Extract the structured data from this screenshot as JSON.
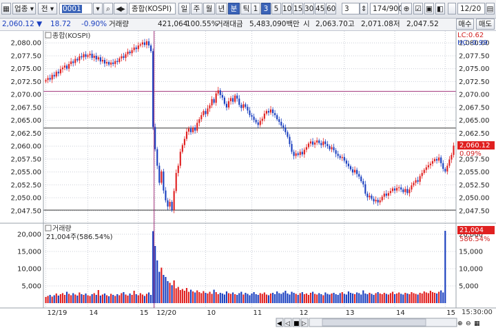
{
  "toolbar": {
    "market_select": "업종",
    "view_select": "전",
    "code_value": "0001",
    "index_name": "종합(KOSPI)",
    "periods": [
      "일",
      "주",
      "월",
      "년",
      "분",
      "틱"
    ],
    "intervals": [
      "1",
      "3",
      "5",
      "10",
      "15",
      "30",
      "45",
      "60"
    ],
    "interval_value": "3",
    "count_value": "174/900",
    "date_value": "12/20"
  },
  "info": {
    "price": "2,060.12",
    "change": "18.72",
    "rate": "-0.90%",
    "vol_label": "거래량",
    "volume": "421,064",
    "vol_ratio": "100.55%",
    "amount_label": "거래대금",
    "amount": "5,483,090백만",
    "open_label": "시",
    "open": "2,063.70",
    "high_label": "고",
    "high": "2,071.08",
    "low_label": "저",
    "low": "2,047.52",
    "buy_label": "매수",
    "sell_label": "매도"
  },
  "panel": {
    "price_title": "종합(KOSPI)",
    "lc_label": "LC:0.62",
    "hc_label": "HC:-0.99",
    "last_price_tag": "2,060.12",
    "last_pct_tag": "0.09%",
    "volume_title": "거래량",
    "volume_subtitle": "21,004주(586.54%)",
    "last_vol_tag": "21,004",
    "last_vol_pct_tag": "586.54%",
    "time_readout": "15:30:00"
  },
  "chart_data": {
    "type": "candlestick",
    "price_axis": {
      "min": 2046.0,
      "max": 2081.5,
      "ticks": [
        2047.5,
        2050,
        2052.5,
        2055,
        2057.5,
        2060,
        2062.5,
        2065,
        2067.5,
        2070,
        2072.5,
        2075,
        2077.5,
        2080
      ],
      "tick_labels": [
        "2,047.50",
        "2,050.00",
        "2,052.50",
        "2,055.00",
        "2,057.50",
        "2,060.00",
        "2,062.50",
        "2,065.00",
        "2,067.50",
        "2,070.00",
        "2,072.50",
        "2,075.00",
        "2,077.50",
        "2,080.00"
      ]
    },
    "volume_axis": {
      "min": 0,
      "max": 22000,
      "ticks": [
        5000,
        10000,
        15000,
        20000
      ],
      "tick_labels": [
        "5,000",
        "10,000",
        "15,000",
        "20,000"
      ]
    },
    "hlines": [
      {
        "value": 2070.6,
        "color": "#a0307a"
      },
      {
        "value": 2063.5,
        "color": "#333333"
      },
      {
        "value": 2047.6,
        "color": "#333333"
      }
    ],
    "x_labels": [
      "12/19",
      "14",
      "15",
      "12/20",
      "10",
      "11",
      "12",
      "13",
      "14",
      "15"
    ],
    "x_label_index": [
      0,
      20,
      44,
      52,
      76,
      98,
      120,
      142,
      166,
      190
    ],
    "session_break_index": 51,
    "close": [
      2072.8,
      2073.2,
      2072.9,
      2073.8,
      2073.5,
      2074.4,
      2074.1,
      2074.9,
      2075.2,
      2075.6,
      2075.0,
      2075.9,
      2076.4,
      2076.1,
      2076.9,
      2076.6,
      2077.4,
      2077.2,
      2077.8,
      2077.3,
      2077.6,
      2077.9,
      2077.1,
      2077.5,
      2076.8,
      2077.2,
      2076.4,
      2076.7,
      2076.0,
      2076.3,
      2075.8,
      2076.2,
      2075.9,
      2076.5,
      2076.3,
      2077.0,
      2077.4,
      2077.1,
      2077.8,
      2078.3,
      2078.0,
      2078.6,
      2079.1,
      2078.8,
      2079.5,
      2079.7,
      2080.1,
      2079.6,
      2080.3,
      2079.5,
      2078.4,
      2063.7,
      2059.4,
      2056.2,
      2052.9,
      2055.1,
      2051.4,
      2049.5,
      2048.3,
      2049.2,
      2047.6,
      2051.3,
      2054.8,
      2056.2,
      2058.9,
      2060.2,
      2061.4,
      2062.8,
      2063.4,
      2062.7,
      2063.6,
      2063.0,
      2064.5,
      2065.2,
      2066.0,
      2066.8,
      2066.2,
      2067.3,
      2067.9,
      2069.1,
      2068.4,
      2070.2,
      2070.8,
      2069.9,
      2069.4,
      2068.2,
      2067.5,
      2068.7,
      2069.3,
      2068.6,
      2069.8,
      2069.2,
      2068.0,
      2067.4,
      2068.1,
      2067.6,
      2066.9,
      2066.0,
      2065.7,
      2065.1,
      2064.6,
      2064.1,
      2064.9,
      2065.3,
      2066.3,
      2066.8,
      2066.5,
      2067.1,
      2066.4,
      2066.0,
      2065.2,
      2064.7,
      2064.0,
      2063.6,
      2062.7,
      2061.8,
      2060.4,
      2058.9,
      2058.1,
      2058.6,
      2058.3,
      2058.9,
      2058.4,
      2059.3,
      2059.8,
      2060.5,
      2060.9,
      2060.3,
      2060.7,
      2061.1,
      2060.6,
      2060.2,
      2060.9,
      2060.4,
      2060.0,
      2059.4,
      2059.8,
      2059.2,
      2058.5,
      2058.1,
      2057.7,
      2057.9,
      2057.2,
      2056.6,
      2056.1,
      2055.5,
      2054.9,
      2055.4,
      2054.6,
      2054.1,
      2053.2,
      2052.6,
      2050.8,
      2050.1,
      2050.4,
      2049.8,
      2049.3,
      2049.6,
      2049.1,
      2049.5,
      2050.2,
      2050.8,
      2050.4,
      2050.9,
      2051.3,
      2051.8,
      2051.4,
      2051.9,
      2052.0,
      2051.6,
      2051.1,
      2051.7,
      2050.9,
      2051.6,
      2052.4,
      2052.9,
      2053.4,
      2053.1,
      2054.2,
      2054.8,
      2055.4,
      2055.9,
      2056.3,
      2056.6,
      2057.1,
      2057.5,
      2057.2,
      2057.8,
      2056.7,
      2055.6,
      2055.1,
      2056.2,
      2057.4,
      2058.3,
      2060.1
    ],
    "volume": [
      1800,
      2100,
      2400,
      1900,
      2300,
      2800,
      2200,
      2600,
      2900,
      2400,
      3300,
      2700,
      2300,
      2900,
      2500,
      2200,
      3100,
      2600,
      2400,
      2800,
      2300,
      2100,
      2600,
      2900,
      2400,
      3800,
      2200,
      2500,
      2800,
      2300,
      2000,
      2700,
      2400,
      2100,
      2600,
      2300,
      2900,
      3200,
      2500,
      2200,
      2800,
      2400,
      3600,
      2600,
      2300,
      2900,
      2500,
      2100,
      2700,
      3100,
      2400,
      20900,
      16600,
      12400,
      9100,
      10300,
      8200,
      7600,
      6400,
      5900,
      5200,
      6600,
      4300,
      4700,
      3800,
      4100,
      3600,
      4400,
      3300,
      3900,
      3400,
      3100,
      3700,
      3200,
      2900,
      3500,
      3000,
      2800,
      3300,
      2700,
      3900,
      3200,
      2600,
      3000,
      2800,
      2500,
      3400,
      2900,
      2700,
      3100,
      2600,
      2400,
      2900,
      3300,
      2500,
      3000,
      2700,
      2300,
      2800,
      3200,
      2600,
      2400,
      2900,
      2700,
      3100,
      2500,
      2300,
      2800,
      3000,
      2600,
      3400,
      2900,
      2700,
      3100,
      3600,
      2800,
      2500,
      3300,
      3000,
      2700,
      2400,
      2900,
      3200,
      2600,
      2800,
      2400,
      3000,
      3300,
      2700,
      2500,
      2900,
      2600,
      2300,
      3100,
      2700,
      2500,
      2800,
      3000,
      2600,
      2400,
      2900,
      3200,
      2700,
      2500,
      3400,
      3000,
      2800,
      2600,
      3100,
      2900,
      2500,
      3700,
      2800,
      2600,
      3000,
      2700,
      2400,
      2900,
      3200,
      2800,
      2600,
      3000,
      2700,
      2500,
      2900,
      3300,
      2600,
      2800,
      3100,
      2700,
      2500,
      3000,
      2800,
      2600,
      3200,
      2900,
      2700,
      2500,
      3000,
      2800,
      3400,
      3100,
      2900,
      3600,
      3200,
      3000,
      2800,
      3300,
      3700,
      3100,
      21000
    ]
  }
}
